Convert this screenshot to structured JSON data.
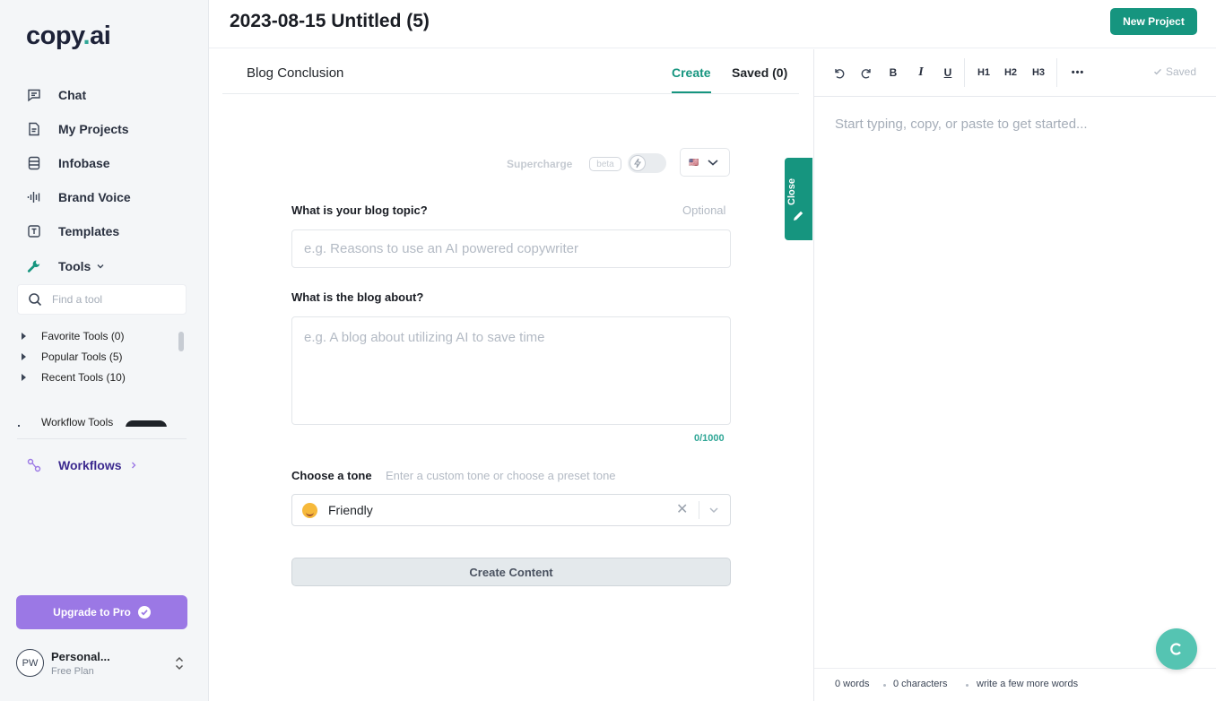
{
  "brand": {
    "logo_main": "copy",
    "logo_dot": ".",
    "logo_tail": "ai"
  },
  "sidebar": {
    "items": [
      {
        "label": "Chat",
        "icon": "chat-icon"
      },
      {
        "label": "My Projects",
        "icon": "document-icon"
      },
      {
        "label": "Infobase",
        "icon": "database-icon"
      },
      {
        "label": "Brand Voice",
        "icon": "soundwave-icon"
      },
      {
        "label": "Templates",
        "icon": "template-icon"
      },
      {
        "label": "Tools",
        "icon": "wrench-icon"
      }
    ],
    "tool_search_placeholder": "Find a tool",
    "tool_tree": [
      {
        "label": "Favorite Tools (0)"
      },
      {
        "label": "Popular Tools (5)"
      },
      {
        "label": "Recent Tools (10)"
      },
      {
        "label": "Workflow Tools"
      }
    ],
    "workflows_label": "Workflows",
    "upgrade_label": "Upgrade to Pro",
    "account": {
      "initials": "PW",
      "name": "Personal...",
      "plan": "Free Plan"
    }
  },
  "header": {
    "title": "2023-08-15 Untitled (5)",
    "new_project": "New Project"
  },
  "tool": {
    "name": "Blog Conclusion",
    "tabs": {
      "create": "Create",
      "saved": "Saved (0)"
    },
    "supercharge": "Supercharge",
    "beta": "beta",
    "language_flag": "🇺🇸",
    "fields": {
      "topic_label": "What is your blog topic?",
      "topic_optional": "Optional",
      "topic_placeholder": "e.g. Reasons to use an AI powered copywriter",
      "about_label": "What is the blog about?",
      "about_placeholder": "e.g. A blog about utilizing AI to save time",
      "about_count": "0/1000",
      "tone_label": "Choose a tone",
      "tone_hint": "Enter a custom tone or choose a preset tone",
      "tone_value": "Friendly",
      "tone_clear": "✕"
    },
    "create_button": "Create Content",
    "close_tab": "Close"
  },
  "editor": {
    "toolbar": {
      "bold": "B",
      "italic": "I",
      "underline": "U",
      "h1": "H1",
      "h2": "H2",
      "h3": "H3",
      "more": "•••",
      "saved": "Saved"
    },
    "placeholder": "Start typing, copy, or paste to get started...",
    "status": {
      "words": "0 words",
      "characters": "0 characters",
      "hint": "write a few more words"
    }
  },
  "colors": {
    "accent": "#16957f",
    "upgrade": "#9b78e5",
    "workflows": "#3c2a8f"
  }
}
